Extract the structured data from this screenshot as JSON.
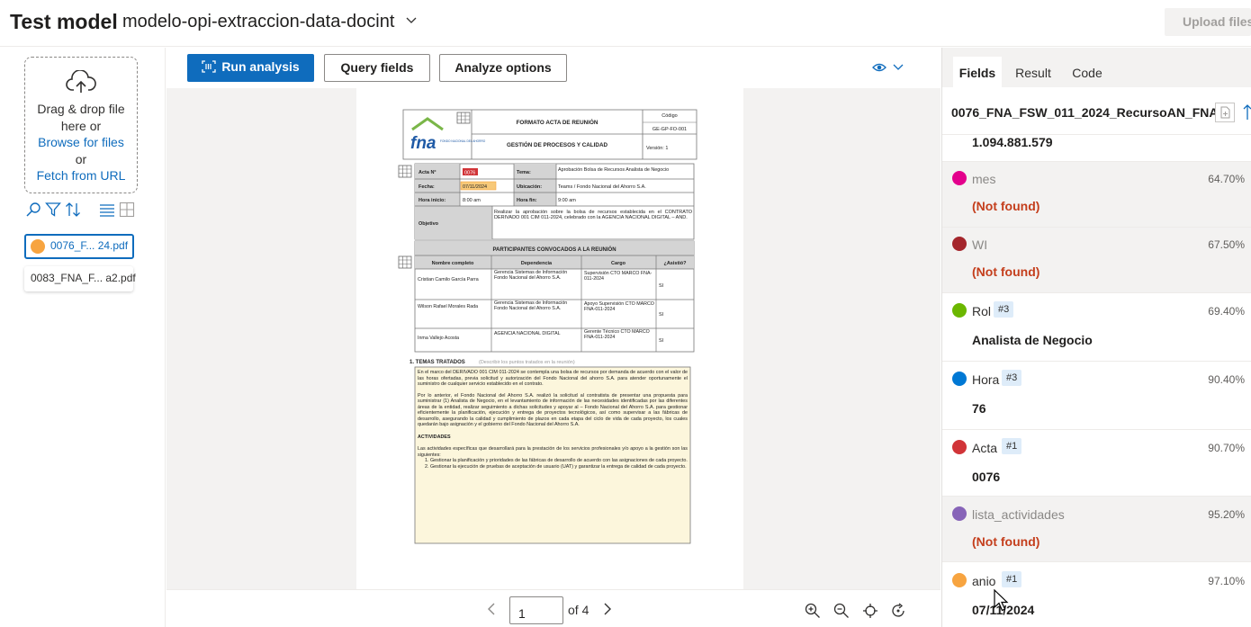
{
  "header": {
    "title": "Test model",
    "model_name": "modelo-opi-extraccion-data-docint",
    "upload_label": "Upload files"
  },
  "upload": {
    "line1": "Drag & drop file",
    "line2": "here or",
    "browse": "Browse for files",
    "or": "or",
    "fetch": "Fetch from URL"
  },
  "files": [
    {
      "name": "0076_F... 24.pdf",
      "status_color": "#f7a440"
    },
    {
      "name": "0083_FNA_F... a2.pdf"
    }
  ],
  "toolbar": {
    "run_label": "Run analysis",
    "query_label": "Query fields",
    "analyze_label": "Analyze options"
  },
  "pager": {
    "current_page": "1",
    "of_label": "of 4"
  },
  "tabs": [
    {
      "label": "Fields",
      "active": true
    },
    {
      "label": "Result",
      "active": false
    },
    {
      "label": "Code",
      "active": false
    }
  ],
  "fields_panel": {
    "file_title": "0076_FNA_FSW_011_2024_RecursoAN_FNA1...",
    "top_value": "1.094.881.579",
    "fields": [
      {
        "name": "mes",
        "color": "#e3008c",
        "confidence": "64.70%",
        "value": "(Not found)",
        "found": false
      },
      {
        "name": "WI",
        "color": "#a4262c",
        "confidence": "67.50%",
        "value": "(Not found)",
        "found": false
      },
      {
        "name": "Rol",
        "color": "#6bb700",
        "badge": "#3",
        "confidence": "69.40%",
        "value": "Analista de Negocio",
        "found": true
      },
      {
        "name": "Hora",
        "color": "#0078d4",
        "badge": "#3",
        "confidence": "90.40%",
        "value": "76",
        "found": true
      },
      {
        "name": "Acta",
        "color": "#d13438",
        "badge": "#1",
        "confidence": "90.70%",
        "value": "0076",
        "found": true
      },
      {
        "name": "lista_actividades",
        "color": "#8764b8",
        "confidence": "95.20%",
        "value": "(Not found)",
        "found": false
      },
      {
        "name": "anio",
        "color": "#f7a440",
        "badge": "#1",
        "confidence": "97.10%",
        "value": "07/11/2024",
        "found": true
      }
    ]
  },
  "document": {
    "header_title": "FORMATO ACTA DE REUNIÓN",
    "header_subtitle": "GESTIÓN DE PROCESOS Y CALIDAD",
    "codigo_label": "Código",
    "codigo": "GE-GP-FO-001",
    "version": "Versión: 1",
    "logo_text": "fna",
    "logo_sub": "FONDO NACIONAL DEL AHORRO",
    "acta_label": "Acta N°",
    "acta_value": "0076",
    "tema_label": "Tema:",
    "tema_value": "Aprobación Bolsa de Recursos Analista de Negocio",
    "fecha_label": "Fecha:",
    "fecha_value": "07/11/2024",
    "ubicacion_label": "Ubicación:",
    "ubicacion_value": "Teams / Fondo Nacional del Ahorro S.A.",
    "hora_inicio_label": "Hora inicio:",
    "hora_inicio": "8:00 am",
    "hora_fin_label": "Hora fin:",
    "hora_fin": "9:00 am",
    "objetivo_label": "Objetivo",
    "objetivo": "Realizar la aprobación sobre la bolsa de recursos establecida en el CONTRATO DERIVADO 001 CIM 011-2024, celebrado con la AGENCIA NACIONAL DIGITAL – AND.",
    "participantes_title": "PARTICIPANTES CONVOCADOS A LA REUNIÓN",
    "col_nombre": "Nombre completo",
    "col_dependencia": "Dependencia",
    "col_cargo": "Cargo",
    "col_asistio": "¿Asistió?",
    "participantes": [
      {
        "nombre": "Cristian Camilo García Parra",
        "dependencia": "Gerencia Sistemas de Información Fondo Nacional del Ahorro S.A.",
        "cargo": "Supervisión CTO MARCO FNA-011-2024",
        "asistio": "SI"
      },
      {
        "nombre": "Wilson Rafael Morales Rada",
        "dependencia": "Gerencia Sistemas de Información Fondo Nacional del Ahorro S.A.",
        "cargo": "Apoyo Supervisión CTO MARCO FNA-011-2024",
        "asistio": "SI"
      },
      {
        "nombre": "Inma Vallejo Acosta",
        "dependencia": "AGENCIA NACIONAL DIGITAL",
        "cargo": "Gerente Técnico CTO MARCO FNA-011-2024",
        "asistio": "SI"
      }
    ],
    "temas_title": "1.  TEMAS TRATADOS",
    "temas_hint": "(Describir los puntos tratados en la reunión)",
    "para1": "En el marco del DERIVADO 001 CIM 011-2024 se contempla una bolsa de recursos por demanda de acuerdo con el valor de las horas ofertadas, previa solicitud y autorización del Fondo Nacional del ahorro S.A. para atender oportunamente el suministro de cualquier servicio establecido en el contrato.",
    "para2": "Por lo anterior, el Fondo Nacional del Ahorro S.A. realizó la solicitud al contratista de presentar una propuesta para suministrar (1) Analista de Negocio, en el levantamiento de información de las necesidades identificadas por las diferentes áreas de la entidad, realizar seguimiento a dichas solicitudes y apoyar al – Fondo Nacional del Ahorro S.A. para gestionar eficientemente la planificación, ejecución y entrega de proyectos tecnológicos, así como supervisar a las fábricas de desarrollo, asegurando la calidad y cumplimiento de plazos en cada etapa del ciclo de vida de cada proyecto, los cuales quedarán bajo asignación y el gobierno del Fondo Nacional del Ahorro S.A.",
    "actividades_title": "ACTIVIDADES",
    "actividades_intro": "Las actividades específicas que desarrollará para la prestación de los servicios profesionales y/o apoyo a la gestión son las siguientes:",
    "act1": "1.   Gestionar la planificación y prioridades de las fábricas de desarrollo de acuerdo con las asignaciones de cada proyecto.",
    "act2": "2.   Gestionar la ejecución de pruebas de aceptación de usuario (UAT) y garantizar la entrega de calidad de cada proyecto."
  }
}
